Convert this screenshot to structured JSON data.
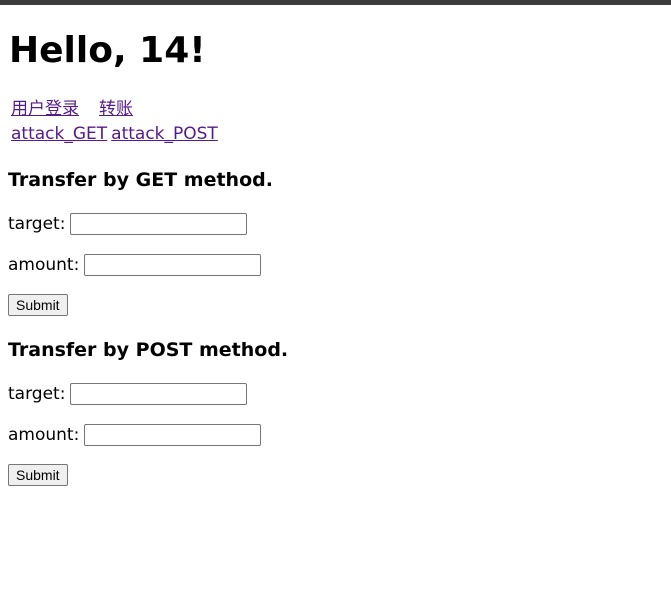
{
  "heading": "Hello, 14!",
  "nav": {
    "login": "用户登录",
    "transfer": "转账",
    "attack_get": "attack_GET",
    "attack_post": "attack_POST"
  },
  "get_form": {
    "title": "Transfer by GET method.",
    "target_label": "target:",
    "amount_label": "amount:",
    "target_value": "",
    "amount_value": "",
    "submit_label": "Submit"
  },
  "post_form": {
    "title": "Transfer by POST method.",
    "target_label": "target:",
    "amount_label": "amount:",
    "target_value": "",
    "amount_value": "",
    "submit_label": "Submit"
  },
  "colors": {
    "link_visited": "#551a8b",
    "top_bar": "#3c3c3c"
  }
}
